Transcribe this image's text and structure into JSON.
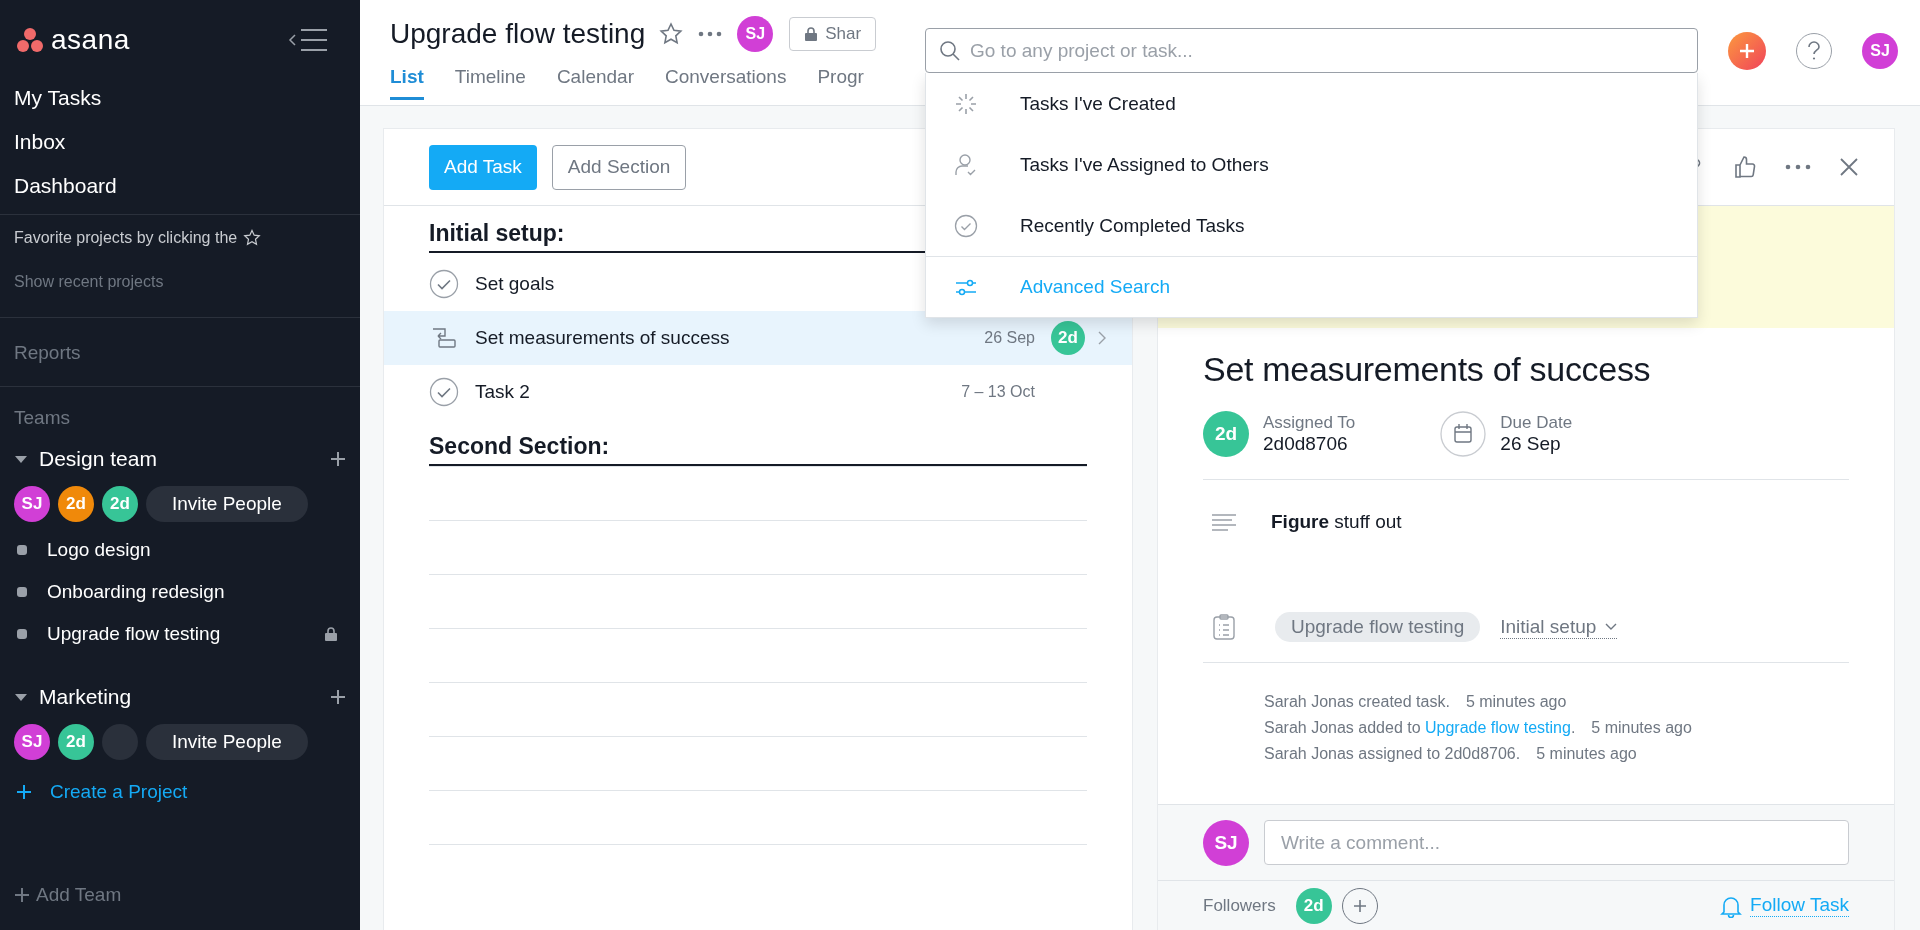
{
  "sidebar": {
    "logo": "asana",
    "nav": [
      {
        "label": "My Tasks"
      },
      {
        "label": "Inbox"
      },
      {
        "label": "Dashboard"
      }
    ],
    "favorites_hint": "Favorite projects by clicking the",
    "show_recent": "Show recent projects",
    "reports": "Reports",
    "teams_heading": "Teams",
    "teams": [
      {
        "name": "Design team",
        "expanded": true,
        "members": [
          {
            "initials": "SJ",
            "color": "#d13fd6"
          },
          {
            "initials": "2d",
            "color": "#f0890a"
          },
          {
            "initials": "2d",
            "color": "#37c597"
          }
        ],
        "invite": "Invite People",
        "projects": [
          {
            "name": "Logo design",
            "locked": false
          },
          {
            "name": "Onboarding redesign",
            "locked": false
          },
          {
            "name": "Upgrade flow testing",
            "locked": true
          }
        ]
      },
      {
        "name": "Marketing",
        "expanded": true,
        "members": [
          {
            "initials": "SJ",
            "color": "#d13fd6"
          },
          {
            "initials": "2d",
            "color": "#37c597"
          },
          {
            "color": "#2a303b"
          }
        ],
        "invite": "Invite People"
      }
    ],
    "create_project": "Create a Project",
    "add_team": "Add Team"
  },
  "header": {
    "title": "Upgrade flow testing",
    "members": [
      {
        "initials": "SJ",
        "color": "#d13fd6"
      }
    ],
    "share": "Shar",
    "tabs": [
      {
        "label": "List",
        "selected": true
      },
      {
        "label": "Timeline",
        "selected": false
      },
      {
        "label": "Calendar",
        "selected": false
      },
      {
        "label": "Conversations",
        "selected": false
      },
      {
        "label": "Progr",
        "selected": false
      }
    ],
    "current_user": {
      "initials": "SJ",
      "color": "#d13fd6"
    }
  },
  "search": {
    "placeholder": "Go to any project or task...",
    "items": [
      {
        "kind": "created",
        "label": "Tasks I've Created"
      },
      {
        "kind": "assigned",
        "label": "Tasks I've Assigned to Others"
      },
      {
        "kind": "completed",
        "label": "Recently Completed Tasks"
      }
    ],
    "advanced": "Advanced Search"
  },
  "list": {
    "add_task": "Add Task",
    "add_section": "Add Section",
    "sections": [
      {
        "title": "Initial setup:",
        "tasks": [
          {
            "kind": "task",
            "name": "Set goals",
            "selected": false
          },
          {
            "kind": "dependent",
            "name": "Set measurements of success",
            "selected": true,
            "date": "26 Sep",
            "assignee": {
              "initials": "2d",
              "color": "#37c597"
            }
          },
          {
            "kind": "task",
            "name": "Task 2",
            "selected": false,
            "date": "7 – 13 Oct"
          }
        ]
      },
      {
        "title": "Second Section:"
      }
    ]
  },
  "detail": {
    "title": "Set measurements of success",
    "assignee": {
      "label": "Assigned To",
      "value": "2d0d8706",
      "avatar": {
        "initials": "2d",
        "color": "#37c597"
      }
    },
    "due": {
      "label": "Due Date",
      "value": "26 Sep"
    },
    "description": "**Figure** stuff out",
    "project": {
      "name": "Upgrade flow testing",
      "section": "Initial setup"
    },
    "activity": [
      {
        "text": "Sarah Jonas created task.",
        "time": "5 minutes ago"
      },
      {
        "text": "Sarah Jonas added to ",
        "link": "Upgrade flow testing",
        "tail": ".",
        "time": "5 minutes ago"
      },
      {
        "text": "Sarah Jonas assigned to 2d0d8706.",
        "time": "5 minutes ago"
      }
    ],
    "commenter": {
      "initials": "SJ",
      "color": "#d13fd6"
    },
    "comment_placeholder": "Write a comment...",
    "followers_label": "Followers",
    "followers": [
      {
        "initials": "2d",
        "color": "#37c597"
      }
    ],
    "follow": "Follow Task"
  }
}
